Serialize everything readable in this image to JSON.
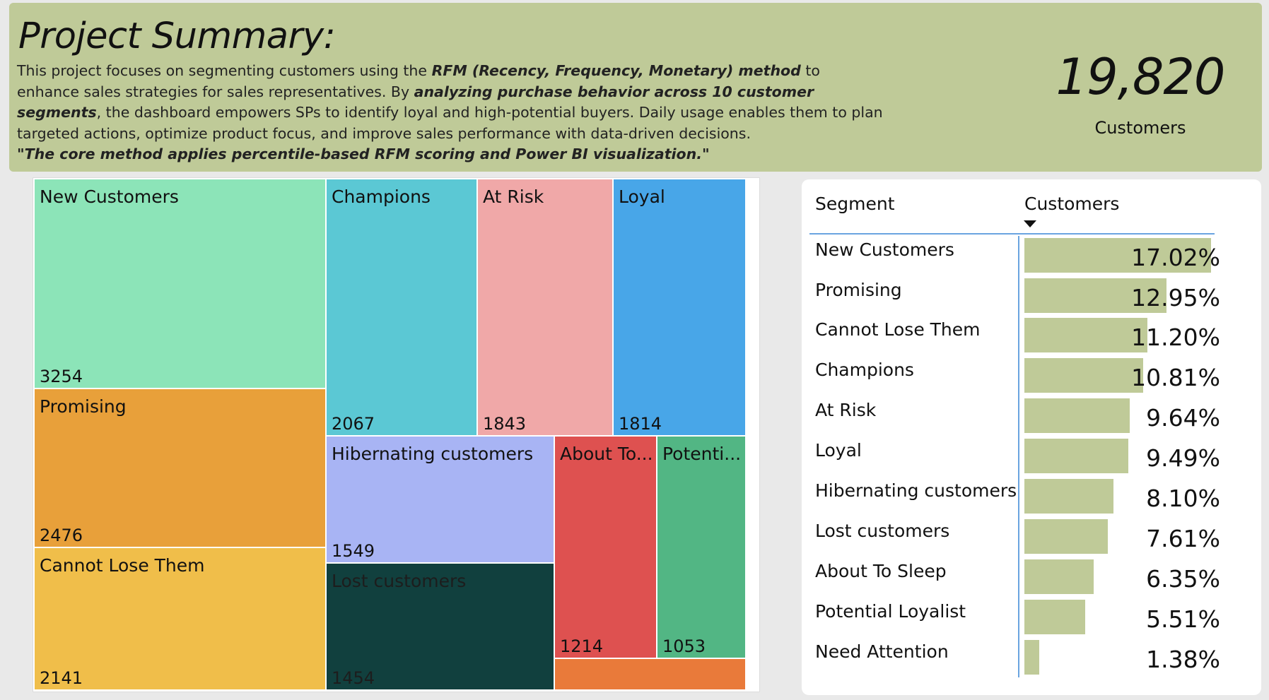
{
  "header": {
    "title": "Project Summary:",
    "desc_1": "This project focuses on segmenting customers using the ",
    "desc_bold_1": "RFM (Recency, Frequency, Monetary) method",
    "desc_2": " to enhance sales strategies for sales representatives. By ",
    "desc_bold_2": "analyzing purchase behavior across 10 customer segments",
    "desc_3": ", the dashboard empowers SPs to identify loyal and high-potential buyers. Daily usage enables them to plan targeted actions, optimize product focus, and improve sales performance with data-driven decisions.",
    "quote": "\"The core method applies percentile-based RFM scoring and Power BI visualization.\"",
    "background": "#bfca98"
  },
  "kpi": {
    "value": "19,820",
    "label": "Customers"
  },
  "treemap": {
    "tiles": [
      {
        "label": "New Customers",
        "value": "3254",
        "color": "#8ce4b8"
      },
      {
        "label": "Promising",
        "value": "2476",
        "color": "#e8a03a"
      },
      {
        "label": "Cannot Lose Them",
        "value": "2141",
        "color": "#f0be4a"
      },
      {
        "label": "Champions",
        "value": "2067",
        "color": "#5bc8d4"
      },
      {
        "label": "At Risk",
        "value": "1843",
        "color": "#f0a8a8"
      },
      {
        "label": "Loyal",
        "value": "1814",
        "color": "#48a6e8"
      },
      {
        "label": "Hibernating customers",
        "value": "1549",
        "color": "#a8b4f4"
      },
      {
        "label": "Lost customers",
        "value": "1454",
        "color": "#11403e"
      },
      {
        "label": "About To...",
        "value": "1214",
        "color": "#de5150"
      },
      {
        "label": "Potenti...",
        "value": "1053",
        "color": "#52b684"
      },
      {
        "label": "",
        "value": "",
        "color": "#e97a3a"
      }
    ]
  },
  "table": {
    "col_segment": "Segment",
    "col_customers": "Customers",
    "rows": [
      {
        "segment": "New Customers",
        "pct": "17.02%"
      },
      {
        "segment": "Promising",
        "pct": "12.95%"
      },
      {
        "segment": "Cannot Lose Them",
        "pct": "11.20%"
      },
      {
        "segment": "Champions",
        "pct": "10.81%"
      },
      {
        "segment": "At Risk",
        "pct": "9.64%"
      },
      {
        "segment": "Loyal",
        "pct": "9.49%"
      },
      {
        "segment": "Hibernating customers",
        "pct": "8.10%"
      },
      {
        "segment": "Lost customers",
        "pct": "7.61%"
      },
      {
        "segment": "About To Sleep",
        "pct": "6.35%"
      },
      {
        "segment": "Potential Loyalist",
        "pct": "5.51%"
      },
      {
        "segment": "Need Attention",
        "pct": "1.38%"
      }
    ],
    "bar_fractions": [
      1.0,
      0.761,
      0.658,
      0.635,
      0.566,
      0.558,
      0.476,
      0.447,
      0.373,
      0.324,
      0.081
    ],
    "bar_color": "#bfca98"
  }
}
